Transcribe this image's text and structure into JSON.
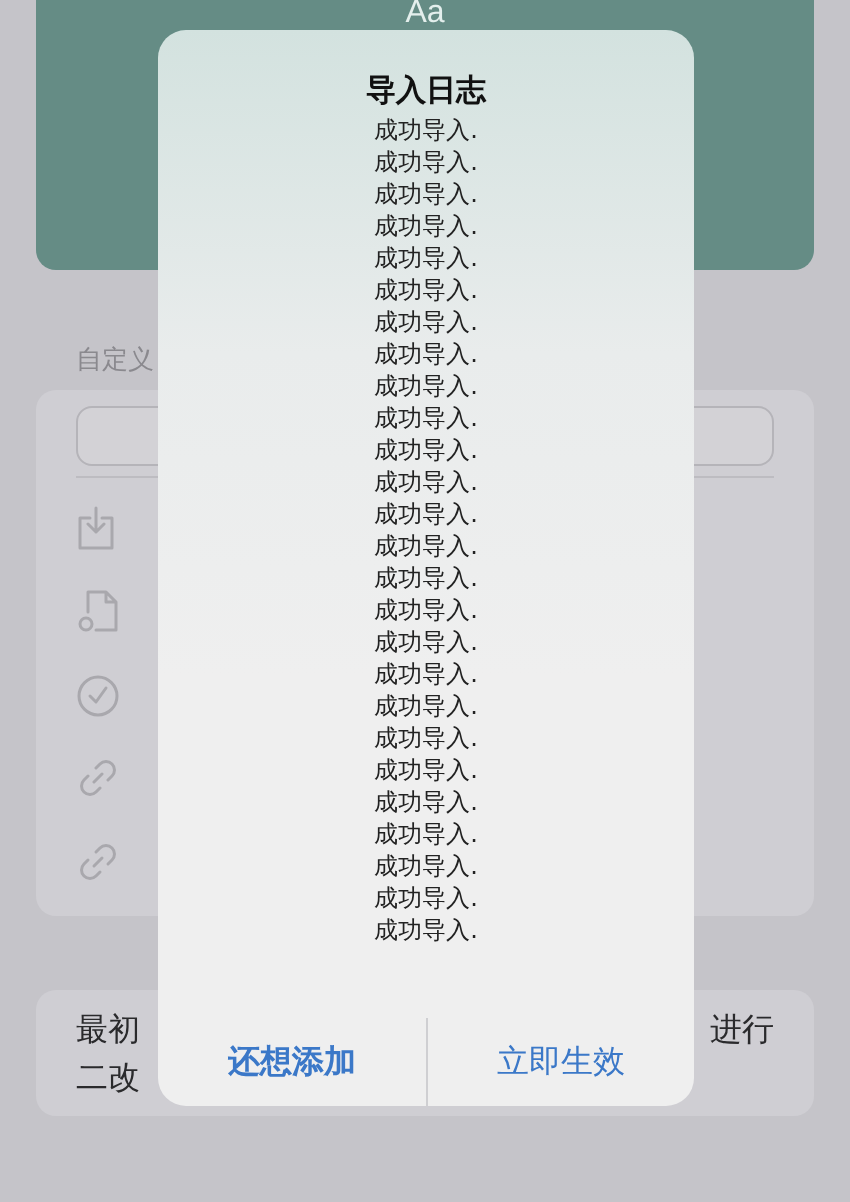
{
  "preview_card": {
    "sample": "Aa"
  },
  "section_label": "自定义",
  "settings_card": {
    "rows": [
      {
        "kind": "import"
      },
      {
        "kind": "file"
      },
      {
        "kind": "check"
      },
      {
        "kind": "link"
      },
      {
        "kind": "link"
      }
    ]
  },
  "note_card": {
    "line_1_left": "最初",
    "line_1_right": "进行",
    "line_2": "二改"
  },
  "alert": {
    "title": "导入日志",
    "log_lines": [
      "成功导入.",
      "成功导入.",
      "成功导入.",
      "成功导入.",
      "成功导入.",
      "成功导入.",
      "成功导入.",
      "成功导入.",
      "成功导入.",
      "成功导入.",
      "成功导入.",
      "成功导入.",
      "成功导入.",
      "成功导入.",
      "成功导入.",
      "成功导入.",
      "成功导入.",
      "成功导入.",
      "成功导入.",
      "成功导入.",
      "成功导入.",
      "成功导入.",
      "成功导入.",
      "成功导入.",
      "成功导入.",
      "成功导入."
    ],
    "buttons": [
      {
        "label": "还想添加",
        "primary": true
      },
      {
        "label": "立即生效",
        "primary": false
      }
    ]
  }
}
